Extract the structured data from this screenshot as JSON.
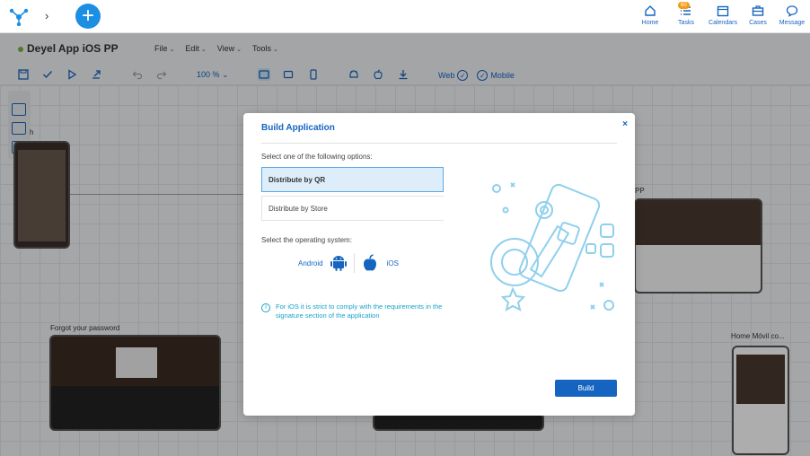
{
  "app": {
    "title": "Deyel App iOS PP"
  },
  "topnav": {
    "items": [
      {
        "label": "Home",
        "icon": "home-icon"
      },
      {
        "label": "Tasks",
        "icon": "tasks-icon",
        "badge": "60"
      },
      {
        "label": "Calendars",
        "icon": "calendar-icon"
      },
      {
        "label": "Cases",
        "icon": "cases-icon"
      },
      {
        "label": "Message",
        "icon": "message-icon"
      }
    ]
  },
  "menus": [
    "File",
    "Edit",
    "View",
    "Tools"
  ],
  "toolbar": {
    "zoom": "100 %",
    "web_label": "Web",
    "mobile_label": "Mobile"
  },
  "canvas": {
    "labels": {
      "forgot": "Forgot your password",
      "home_movil": "Home Móvil co...",
      "pp": "PP",
      "h": "h"
    }
  },
  "modal": {
    "title": "Build Application",
    "close": "×",
    "prompt": "Select one of the following options:",
    "options": [
      "Distribute by QR",
      "Distribute by Store"
    ],
    "os_prompt": "Select the operating system:",
    "os": {
      "android": "Android",
      "ios": "iOS"
    },
    "info": "For iOS it is strict to comply with the requirements in the signature section of the application",
    "info_icon": "i",
    "build_label": "Build"
  },
  "colors": {
    "accent": "#1565c0",
    "plus": "#1c8fe3",
    "info": "#16a3c8",
    "selected_bg": "#ddeefa"
  }
}
